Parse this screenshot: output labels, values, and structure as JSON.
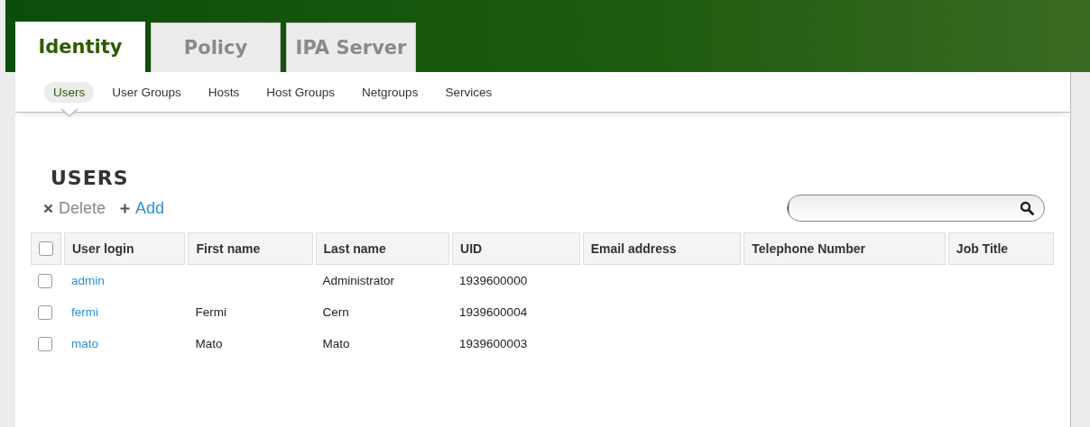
{
  "tabs": [
    {
      "label": "Identity",
      "selected": true
    },
    {
      "label": "Policy",
      "selected": false
    },
    {
      "label": "IPA Server",
      "selected": false
    }
  ],
  "subnav": [
    {
      "label": "Users",
      "selected": true
    },
    {
      "label": "User Groups",
      "selected": false
    },
    {
      "label": "Hosts",
      "selected": false
    },
    {
      "label": "Host Groups",
      "selected": false
    },
    {
      "label": "Netgroups",
      "selected": false
    },
    {
      "label": "Services",
      "selected": false
    }
  ],
  "page_title": "USERS",
  "actions": [
    {
      "kind": "delete",
      "label": "Delete",
      "disabled": true
    },
    {
      "kind": "add",
      "label": "Add",
      "disabled": false
    }
  ],
  "table": {
    "select_all": false,
    "columns": [
      "User login",
      "First name",
      "Last name",
      "UID",
      "Email address",
      "Telephone Number",
      "Job Title"
    ],
    "rows": [
      {
        "checked": false,
        "cells": [
          "admin",
          "",
          "Administrator",
          "1939600000",
          "",
          "",
          ""
        ]
      },
      {
        "checked": false,
        "cells": [
          "fermi",
          "Fermi",
          "Cern",
          "1939600004",
          "",
          "",
          ""
        ]
      },
      {
        "checked": false,
        "cells": [
          "mato",
          "Mato",
          "Mato",
          "1939600003",
          "",
          "",
          ""
        ]
      }
    ]
  }
}
